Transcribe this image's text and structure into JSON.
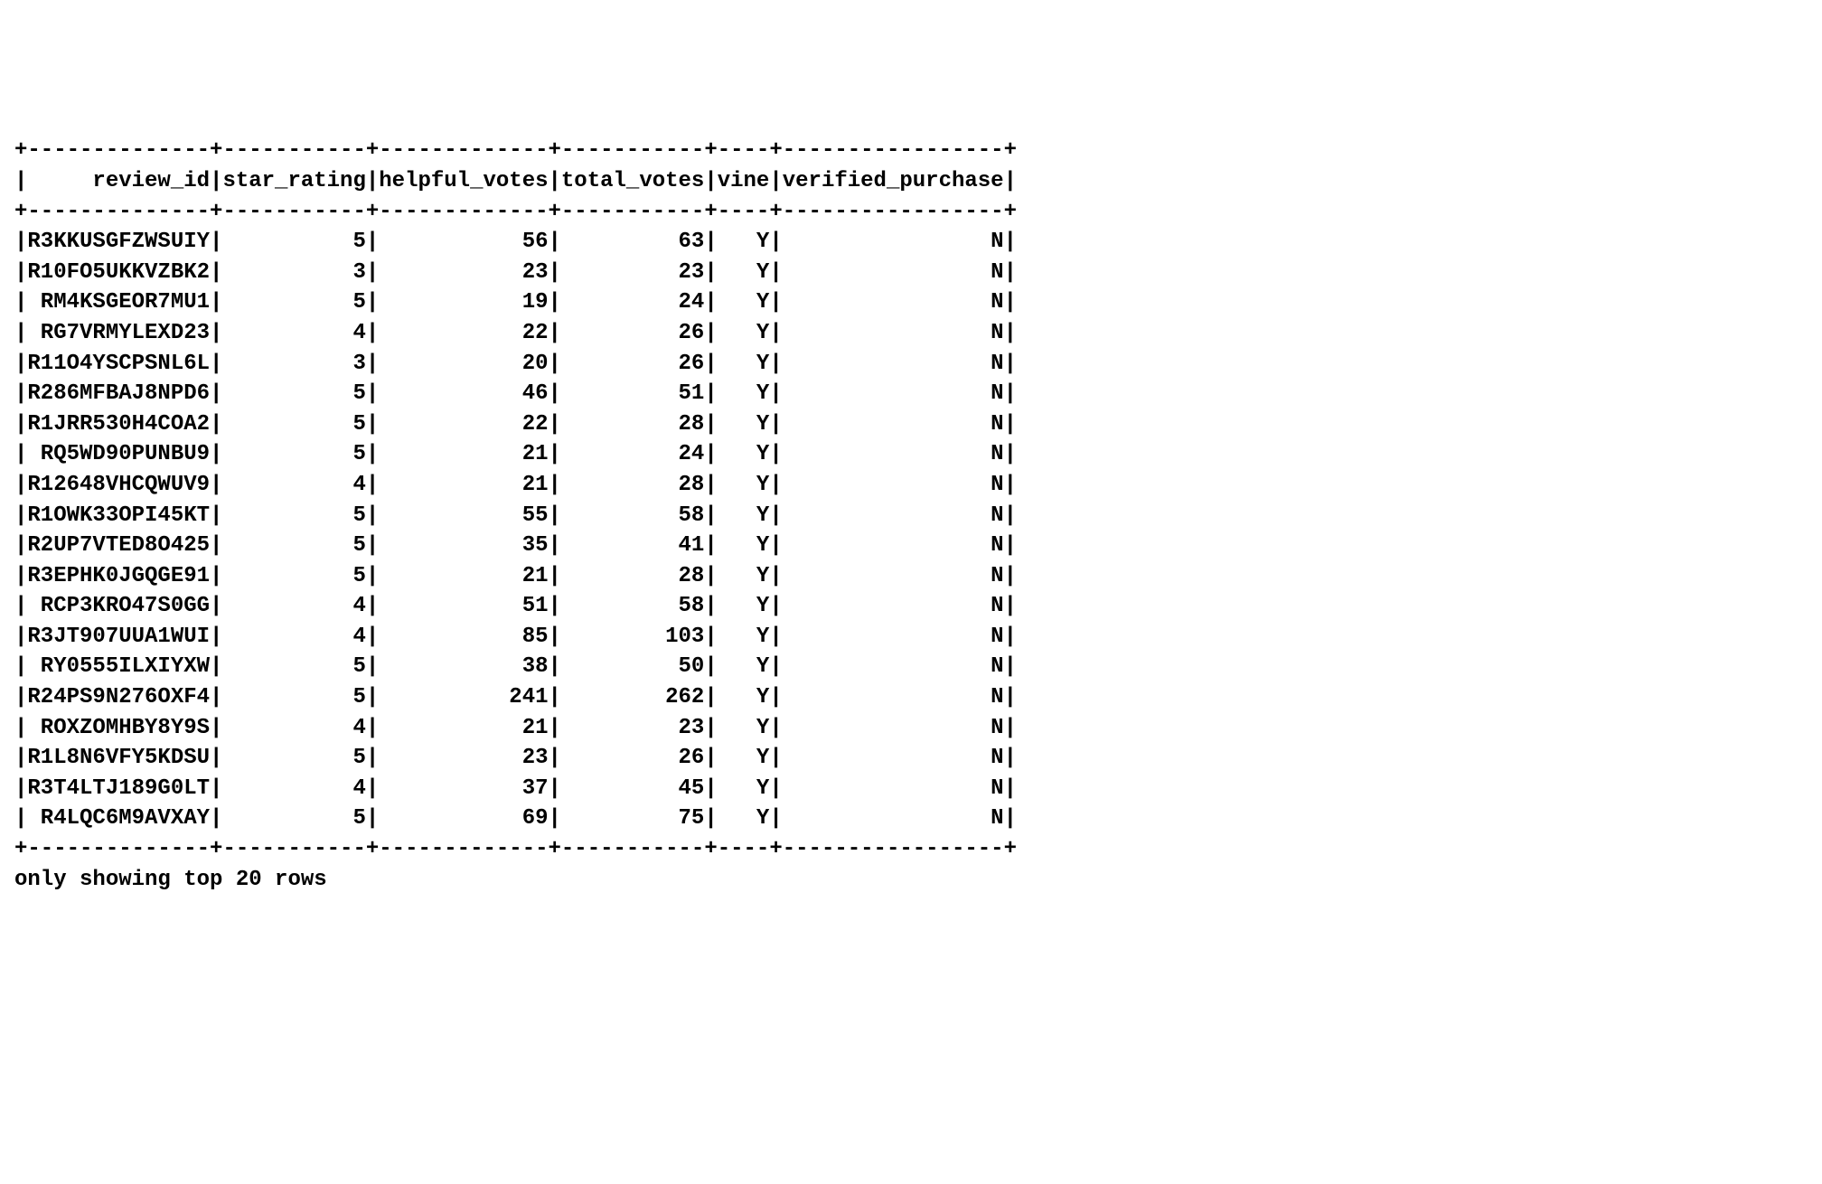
{
  "columns": [
    {
      "name": "review_id",
      "width": 14
    },
    {
      "name": "star_rating",
      "width": 11
    },
    {
      "name": "helpful_votes",
      "width": 13
    },
    {
      "name": "total_votes",
      "width": 11
    },
    {
      "name": "vine",
      "width": 4
    },
    {
      "name": "verified_purchase",
      "width": 17
    }
  ],
  "rows": [
    {
      "review_id": "R3KKUSGFZWSUIY",
      "star_rating": 5,
      "helpful_votes": 56,
      "total_votes": 63,
      "vine": "Y",
      "verified_purchase": "N"
    },
    {
      "review_id": "R10FO5UKKVZBK2",
      "star_rating": 3,
      "helpful_votes": 23,
      "total_votes": 23,
      "vine": "Y",
      "verified_purchase": "N"
    },
    {
      "review_id": "RM4KSGEOR7MU1",
      "star_rating": 5,
      "helpful_votes": 19,
      "total_votes": 24,
      "vine": "Y",
      "verified_purchase": "N"
    },
    {
      "review_id": "RG7VRMYLEXD23",
      "star_rating": 4,
      "helpful_votes": 22,
      "total_votes": 26,
      "vine": "Y",
      "verified_purchase": "N"
    },
    {
      "review_id": "R11O4YSCPSNL6L",
      "star_rating": 3,
      "helpful_votes": 20,
      "total_votes": 26,
      "vine": "Y",
      "verified_purchase": "N"
    },
    {
      "review_id": "R286MFBAJ8NPD6",
      "star_rating": 5,
      "helpful_votes": 46,
      "total_votes": 51,
      "vine": "Y",
      "verified_purchase": "N"
    },
    {
      "review_id": "R1JRR530H4COA2",
      "star_rating": 5,
      "helpful_votes": 22,
      "total_votes": 28,
      "vine": "Y",
      "verified_purchase": "N"
    },
    {
      "review_id": "RQ5WD90PUNBU9",
      "star_rating": 5,
      "helpful_votes": 21,
      "total_votes": 24,
      "vine": "Y",
      "verified_purchase": "N"
    },
    {
      "review_id": "R12648VHCQWUV9",
      "star_rating": 4,
      "helpful_votes": 21,
      "total_votes": 28,
      "vine": "Y",
      "verified_purchase": "N"
    },
    {
      "review_id": "R1OWK33OPI45KT",
      "star_rating": 5,
      "helpful_votes": 55,
      "total_votes": 58,
      "vine": "Y",
      "verified_purchase": "N"
    },
    {
      "review_id": "R2UP7VTED8O425",
      "star_rating": 5,
      "helpful_votes": 35,
      "total_votes": 41,
      "vine": "Y",
      "verified_purchase": "N"
    },
    {
      "review_id": "R3EPHK0JGQGE91",
      "star_rating": 5,
      "helpful_votes": 21,
      "total_votes": 28,
      "vine": "Y",
      "verified_purchase": "N"
    },
    {
      "review_id": "RCP3KRO47S0GG",
      "star_rating": 4,
      "helpful_votes": 51,
      "total_votes": 58,
      "vine": "Y",
      "verified_purchase": "N"
    },
    {
      "review_id": "R3JT907UUA1WUI",
      "star_rating": 4,
      "helpful_votes": 85,
      "total_votes": 103,
      "vine": "Y",
      "verified_purchase": "N"
    },
    {
      "review_id": "RY0555ILXIYXW",
      "star_rating": 5,
      "helpful_votes": 38,
      "total_votes": 50,
      "vine": "Y",
      "verified_purchase": "N"
    },
    {
      "review_id": "R24PS9N276OXF4",
      "star_rating": 5,
      "helpful_votes": 241,
      "total_votes": 262,
      "vine": "Y",
      "verified_purchase": "N"
    },
    {
      "review_id": "ROXZOMHBY8Y9S",
      "star_rating": 4,
      "helpful_votes": 21,
      "total_votes": 23,
      "vine": "Y",
      "verified_purchase": "N"
    },
    {
      "review_id": "R1L8N6VFY5KDSU",
      "star_rating": 5,
      "helpful_votes": 23,
      "total_votes": 26,
      "vine": "Y",
      "verified_purchase": "N"
    },
    {
      "review_id": "R3T4LTJ189G0LT",
      "star_rating": 4,
      "helpful_votes": 37,
      "total_votes": 45,
      "vine": "Y",
      "verified_purchase": "N"
    },
    {
      "review_id": "R4LQC6M9AVXAY",
      "star_rating": 5,
      "helpful_votes": 69,
      "total_votes": 75,
      "vine": "Y",
      "verified_purchase": "N"
    }
  ],
  "footer": "only showing top 20 rows"
}
